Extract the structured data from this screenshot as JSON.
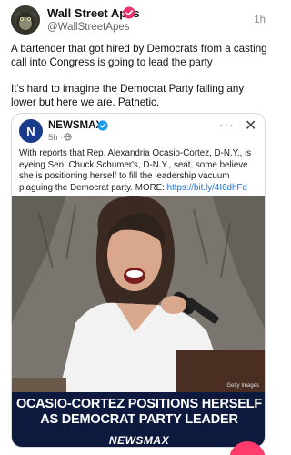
{
  "post": {
    "author_name": "Wall Street Apes",
    "handle": "@WallStreetApes",
    "time": "1h",
    "paragraph_1": "A bartender that got hired by Democrats from a casting call into Congress is going to lead the party",
    "paragraph_2": "It's hard to imagine the Democrat Party falling any lower but here we are. Pathetic."
  },
  "quote": {
    "logo_letter": "N",
    "source_name": "NEWSMAX",
    "time": "5h ·",
    "body": "With reports that Rep. Alexandria Ocasio-Cortez, D-N.Y., is eyeing Sen. Chuck Schumer's, D-N.Y., seat, some believe she is positioning herself to fill the leadership vacuum plaguing the Democrat party. MORE: ",
    "link": "https://bit.ly/4I6dhFd",
    "more_glyph": "···",
    "close_glyph": "✕",
    "image_credit": "Getty Images",
    "headline": "OCASIO-CORTEZ POSITIONS HERSELF AS DEMOCRAT PARTY LEADER",
    "brand": "NEWSMAX"
  },
  "icons": {
    "verified": "verified-badge-icon",
    "globe": "globe-icon",
    "more": "more-options-icon",
    "close": "close-icon"
  },
  "colors": {
    "verified_badge": "#e8336d",
    "link": "#1d6fd6",
    "headline_bg": "#0d1a3e",
    "fab": "#ff3b6b"
  }
}
